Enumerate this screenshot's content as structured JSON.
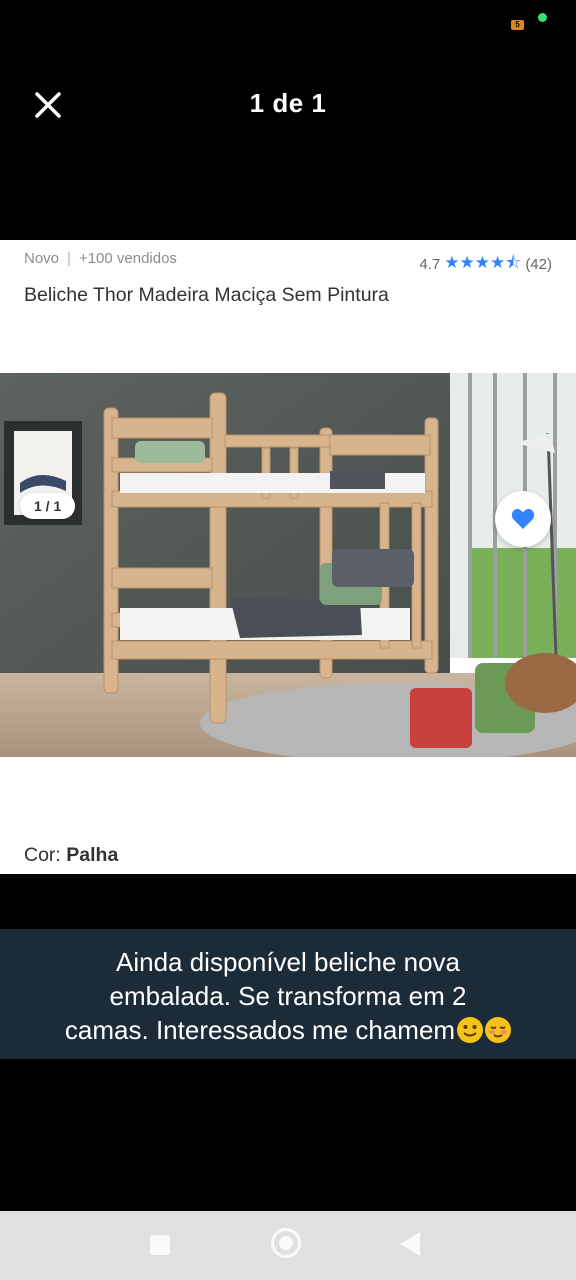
{
  "status_bar": {
    "battery_label": "5"
  },
  "viewer": {
    "counter": "1 de 1"
  },
  "product": {
    "condition": "Novo",
    "sold": "+100 vendidos",
    "rating": "4.7",
    "reviews": "(42)",
    "stars_value": 4.7,
    "title": "Beliche Thor Madeira Maciça Sem Pintura",
    "image_counter": "1 / 1",
    "color_label": "Cor:",
    "color_value": "Palha",
    "accent_color": "#3483fa"
  },
  "caption": {
    "line1": "Ainda disponível beliche nova",
    "line2": "embalada. Se transforma em 2",
    "line3": "camas. Interessados me chamem"
  },
  "icons": [
    "close-icon",
    "heart-icon",
    "share-icon",
    "star-icon",
    "nav-recents-icon",
    "nav-home-icon",
    "nav-back-icon"
  ]
}
